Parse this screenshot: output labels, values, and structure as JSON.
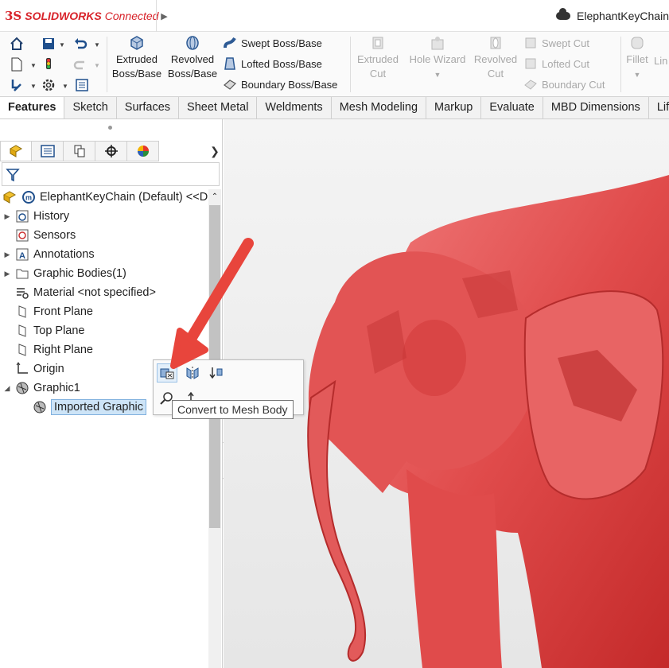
{
  "titlebar": {
    "brand_ds": "3S",
    "brand_solid": "SOLID",
    "brand_works": "WORKS",
    "brand_connected": "Connected",
    "document_title": "ElephantKeyChain"
  },
  "ribbon": {
    "big_buttons": [
      {
        "line1": "Extruded",
        "line2": "Boss/Base",
        "disabled": false
      },
      {
        "line1": "Revolved",
        "line2": "Boss/Base",
        "disabled": false
      },
      {
        "line1": "Extruded",
        "line2": "Cut",
        "disabled": true
      },
      {
        "line1": "Hole Wizard",
        "line2": "",
        "disabled": true
      },
      {
        "line1": "Revolved",
        "line2": "Cut",
        "disabled": true
      },
      {
        "line1": "Fillet",
        "line2": "",
        "disabled": true
      },
      {
        "line1": "Lin",
        "line2": "",
        "disabled": true
      }
    ],
    "small_buttons": [
      {
        "label": "Swept Boss/Base",
        "disabled": false
      },
      {
        "label": "Lofted Boss/Base",
        "disabled": false
      },
      {
        "label": "Boundary Boss/Base",
        "disabled": false
      },
      {
        "label": "Swept Cut",
        "disabled": true
      },
      {
        "label": "Lofted Cut",
        "disabled": true
      },
      {
        "label": "Boundary Cut",
        "disabled": true
      }
    ]
  },
  "tabs": [
    "Features",
    "Sketch",
    "Surfaces",
    "Sheet Metal",
    "Weldments",
    "Mesh Modeling",
    "Markup",
    "Evaluate",
    "MBD Dimensions",
    "Life"
  ],
  "active_tab": "Features",
  "tree": {
    "root": "ElephantKeyChain (Default) <<D",
    "items": [
      {
        "label": "History",
        "expandable": true,
        "icon": "history-icon"
      },
      {
        "label": "Sensors",
        "expandable": false,
        "icon": "sensors-icon"
      },
      {
        "label": "Annotations",
        "expandable": true,
        "icon": "annotations-icon"
      },
      {
        "label": "Graphic Bodies(1)",
        "expandable": true,
        "icon": "folder-icon"
      },
      {
        "label": "Material <not specified>",
        "expandable": false,
        "icon": "material-icon"
      },
      {
        "label": "Front Plane",
        "expandable": false,
        "icon": "plane-icon"
      },
      {
        "label": "Top Plane",
        "expandable": false,
        "icon": "plane-icon"
      },
      {
        "label": "Right Plane",
        "expandable": false,
        "icon": "plane-icon"
      },
      {
        "label": "Origin",
        "expandable": false,
        "icon": "origin-icon"
      },
      {
        "label": "Graphic1",
        "expandable": true,
        "expanded": true,
        "icon": "graphic-body-icon"
      },
      {
        "label": "Imported Graphic",
        "expandable": false,
        "icon": "imported-graphic-icon",
        "selected": true
      }
    ]
  },
  "context_toolbar": {
    "tooltip": "Convert to Mesh Body"
  },
  "colors": {
    "brand_red": "#d8232a",
    "model_red": "#e04b4b",
    "selection_blue": "#cde4f7",
    "annotation_arrow": "#e8453c"
  }
}
